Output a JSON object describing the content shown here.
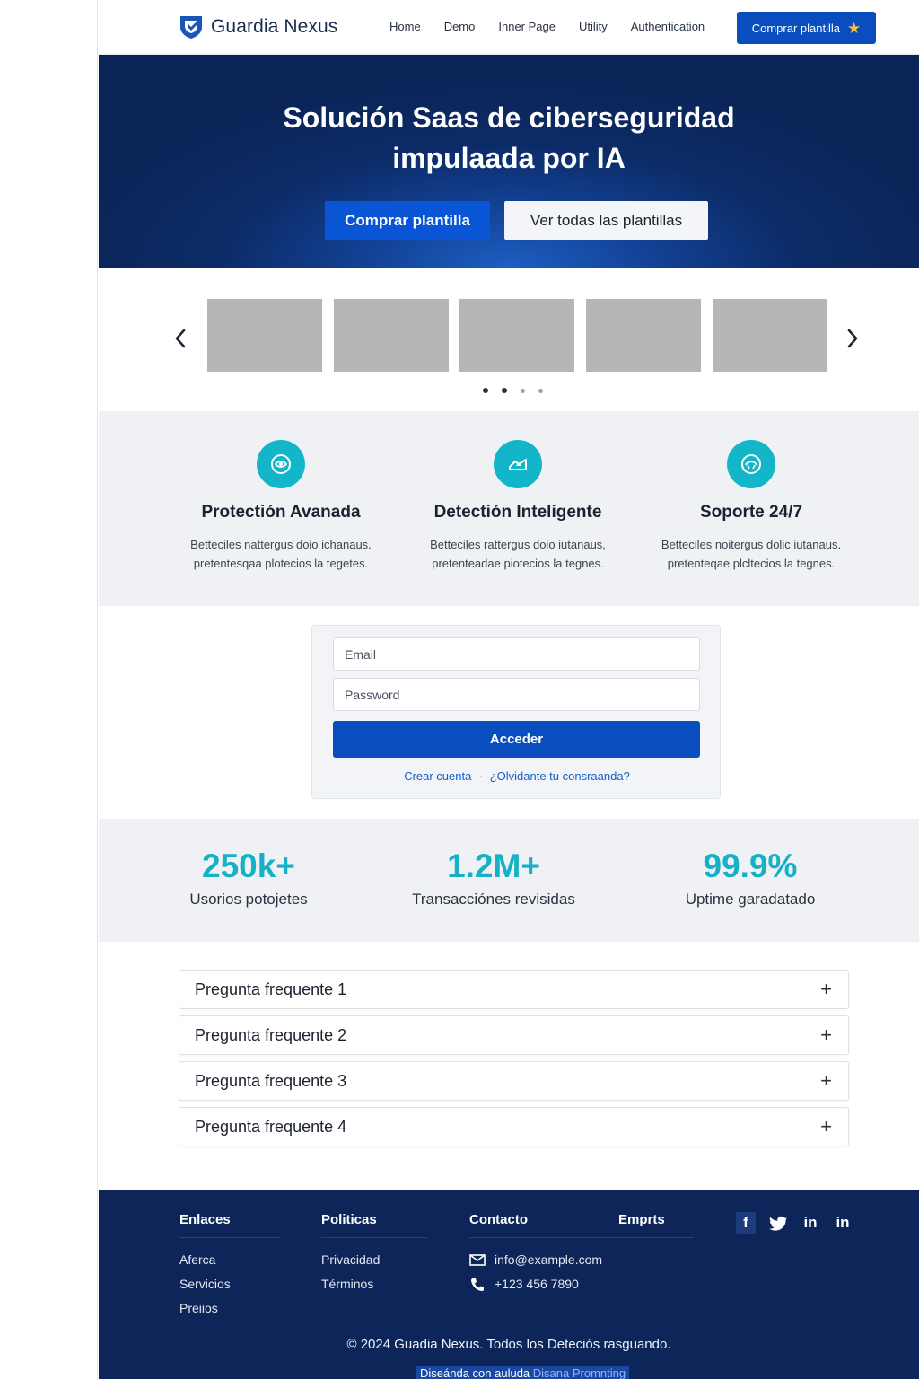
{
  "header": {
    "brand": "Guardia Nexus",
    "nav": [
      "Home",
      "Demo",
      "Inner Page",
      "Utility",
      "Authentication"
    ],
    "cta": "Comprar plantilla",
    "cta_icon": "star-icon",
    "accent": "#0a4dbf"
  },
  "hero": {
    "title_line1": "Solución Saas de ciberseguridad",
    "title_line2": "impulaada por IA",
    "primary_button": "Comprar plantilla",
    "secondary_button": "Ver todas las plantillas"
  },
  "carousel": {
    "slides": 5,
    "dots": 4,
    "active_dot": 2
  },
  "features": [
    {
      "title": "Protectión Avanada",
      "desc_line1": "Betteciles nattergus doio ichanaus.",
      "desc_line2": "pretentesqaa plotecios la tegetes.",
      "icon": "shield-eye-icon"
    },
    {
      "title": "Detectión Inteligente",
      "desc_line1": "Betteciles rattergus doio iutanaus,",
      "desc_line2": "pretenteadae piotecios la tegnes.",
      "icon": "hand-shield-icon"
    },
    {
      "title": "Soporte 24/7",
      "desc_line1": "Betteciles noitergus dolic iutanaus.",
      "desc_line2": "pretenteqae plcltecios la tegnes.",
      "icon": "headset-icon"
    }
  ],
  "login": {
    "email_placeholder": "Email",
    "password_placeholder": "Password",
    "submit": "Acceder",
    "link_create": "Crear cuenta",
    "separator": "·",
    "link_forgot": "¿Olvidante tu consraanda?"
  },
  "stats": [
    {
      "value": "250k+",
      "label": "Usorios potojetes"
    },
    {
      "value": "1.2M+",
      "label": "Transacciónes revisidas"
    },
    {
      "value": "99.9%",
      "label": "Uptime garadatado"
    }
  ],
  "faq": [
    "Pregunta frequente 1",
    "Pregunta frequente 2",
    "Pregunta frequente 3",
    "Pregunta frequente 4"
  ],
  "footer": {
    "col1_title": "Enlaces",
    "col1_links": [
      "Aferca",
      "Servicios",
      "Preiios"
    ],
    "col2_title": "Politicas",
    "col2_links": [
      "Privacidad",
      "Términos"
    ],
    "col3_title": "Contacto",
    "email": "info@example.com",
    "phone": "+123 456 7890",
    "col4_title": "Emprts",
    "socials": [
      "facebook-icon",
      "twitter-icon",
      "linkedin-icon",
      "linkedin-icon"
    ],
    "copyright": "© 2024 Guadia Nexus. Todos los Deteciós rasguando.",
    "credit_prefix": "Diseánda con auluda",
    "credit_highlight": "Disana Promnting"
  },
  "colors": {
    "hero_dark": "#0a2457",
    "teal": "#15b1c7",
    "footer_bg": "#0d2558"
  }
}
